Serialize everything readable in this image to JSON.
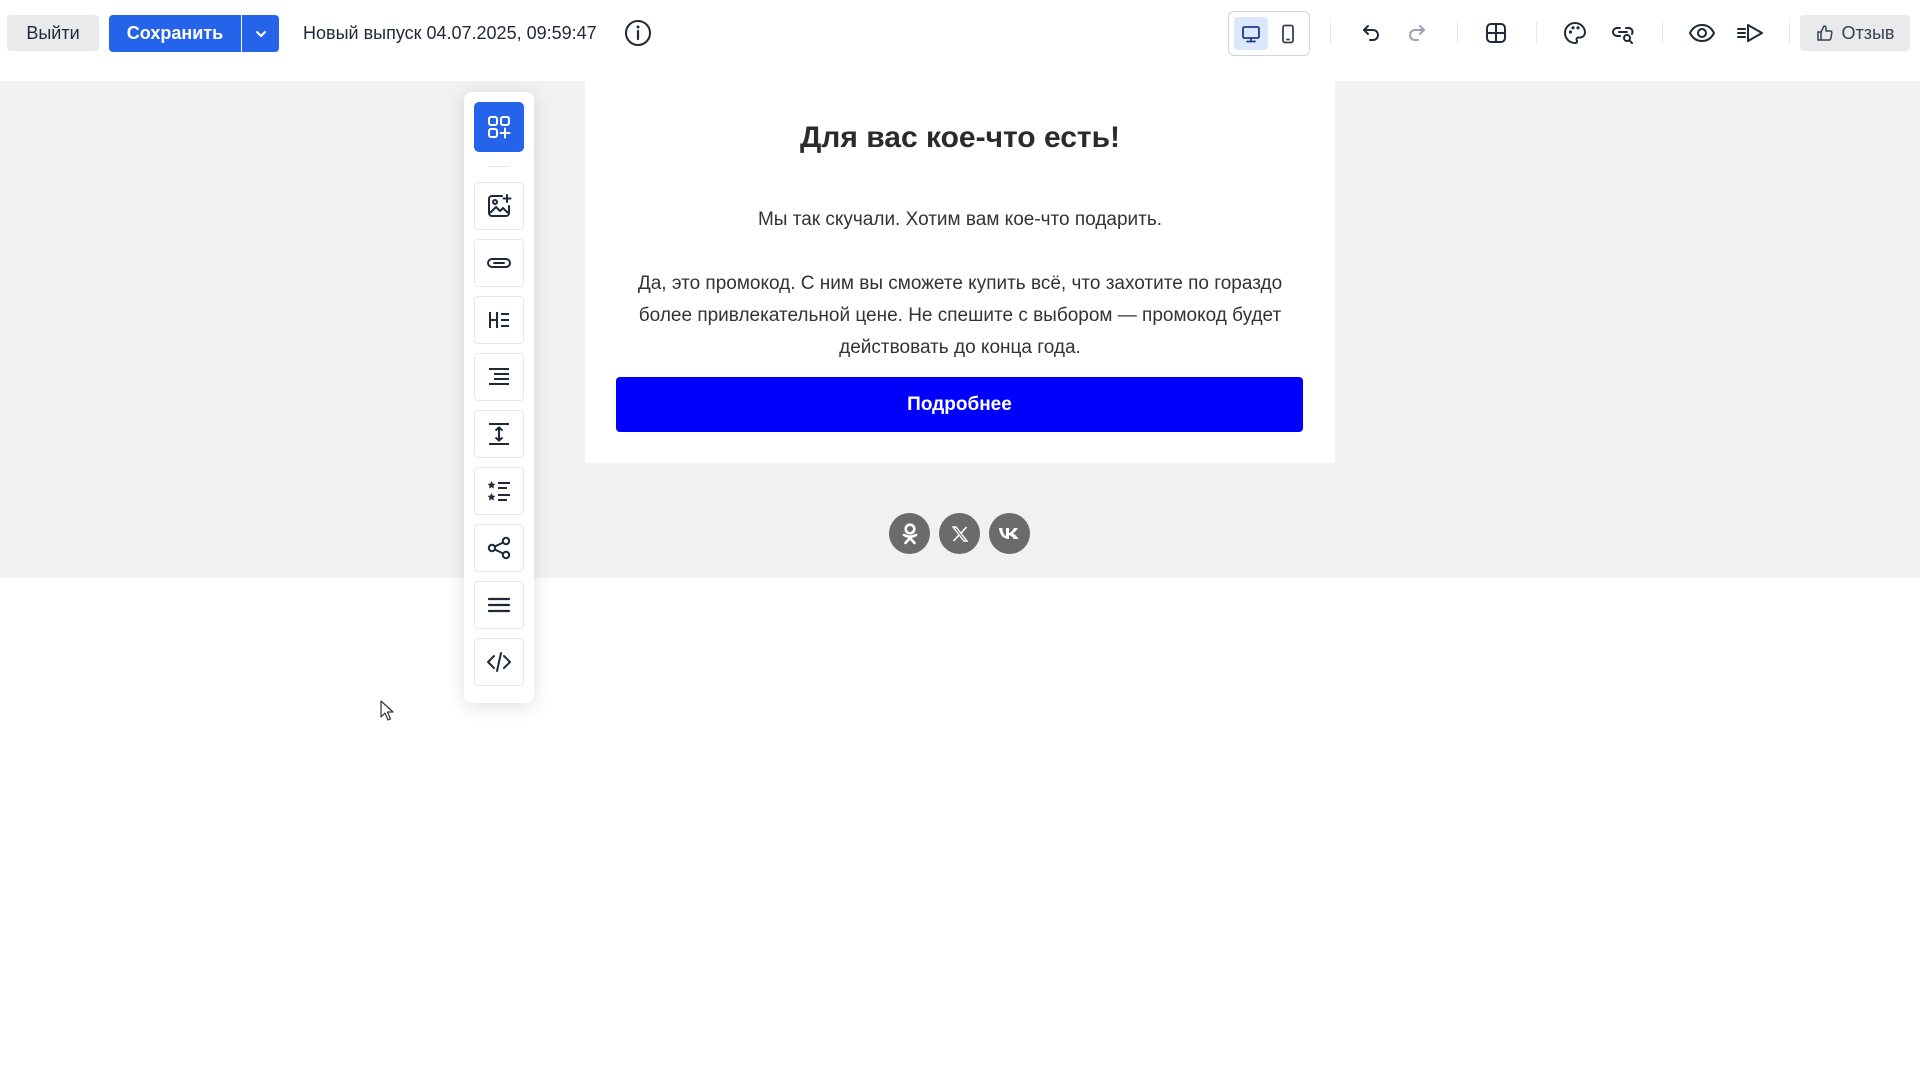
{
  "toolbar": {
    "exit_label": "Выйти",
    "save_label": "Сохранить",
    "release_title": "Новый выпуск 04.07.2025, 09:59:47",
    "feedback_label": "Отзыв",
    "icons": [
      "info-icon",
      "desktop-icon",
      "mobile-icon",
      "undo-icon",
      "redo-icon",
      "grid-icon",
      "palette-icon",
      "link-search-icon",
      "preview-eye-icon",
      "send-test-icon",
      "thumbs-up-icon"
    ]
  },
  "email": {
    "heading": "Для вас кое-что есть!",
    "lead": "Мы так скучали. Хотим вам кое-что подарить.",
    "body": "Да, это промокод. С ним вы сможете купить всё, что захотите по гораздо более привлекательной цене. Не спешите с выбором — промокод будет действовать до конца года.",
    "cta_label": "Подробнее",
    "cta_color": "#0000ff",
    "social": [
      "ok-icon",
      "x-icon",
      "vk-icon"
    ]
  },
  "palette": {
    "items": [
      "add-block-icon",
      "image-icon",
      "button-icon",
      "heading-icon",
      "text-icon",
      "spacer-icon",
      "list-icon",
      "share-icon",
      "menu-icon",
      "code-icon"
    ]
  },
  "colors": {
    "accent": "#2563eb",
    "canvas": "#f1f1f2"
  }
}
